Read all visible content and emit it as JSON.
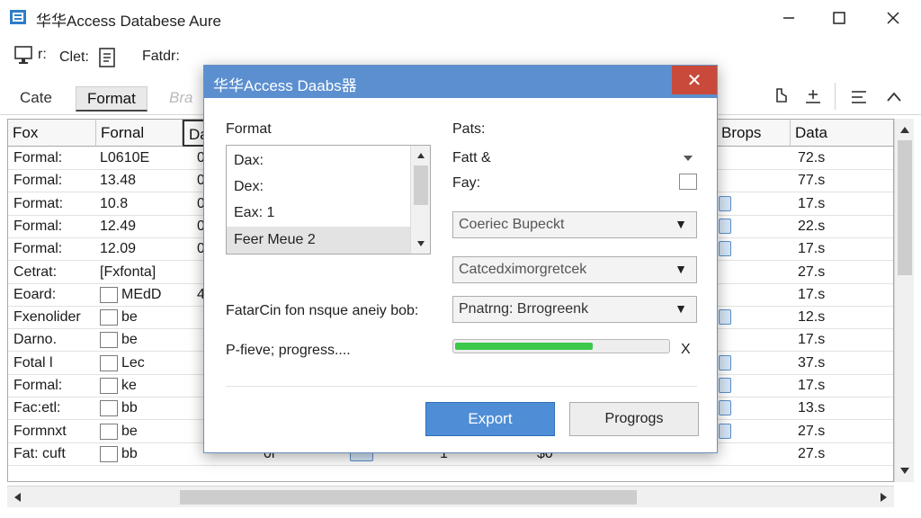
{
  "window": {
    "title": "华华Access Databese Aure",
    "minimize_icon": "minimize-icon",
    "maximize_icon": "maximize-icon",
    "close_icon": "close-icon"
  },
  "toolbar": {
    "item1_label": "r:",
    "item2_label": "Clet:",
    "item3_label": "Fatdr:"
  },
  "ribbon": {
    "tabs": [
      {
        "label": "Cate"
      },
      {
        "label": "Format"
      },
      {
        "label": "Bra"
      }
    ],
    "right_icons": [
      "bookmark-icon",
      "add-icon",
      "list-icon",
      "chevron-up-icon"
    ]
  },
  "grid": {
    "headers": [
      "Fox",
      "Fornal",
      "Da",
      "Brops",
      "Data"
    ],
    "rows": [
      {
        "c1": "Formal:",
        "c2": "L0610E",
        "c3": "0",
        "c5": "72.s",
        "box": false
      },
      {
        "c1": "Formal:",
        "c2": "13.48",
        "c3": "0",
        "c5": "77.s",
        "box": false
      },
      {
        "c1": "Format:",
        "c2": "10.8",
        "c3": "0",
        "c5": "17.s",
        "box": true
      },
      {
        "c1": "Formal:",
        "c2": "12.49",
        "c3": "0",
        "c5": "22.s",
        "box": true
      },
      {
        "c1": "Formal:",
        "c2": "12.09",
        "c3": "0",
        "c5": "17.s",
        "box": true
      },
      {
        "c1": "Cetrat:",
        "c2": "[Fxfonta]",
        "c3": "",
        "c5": "27.s",
        "box": false
      },
      {
        "c1": "Eoard:",
        "c2": "MEdD",
        "c3": "4",
        "c5": "17.s",
        "box": false,
        "cb": true
      },
      {
        "c1": "Fxenolider",
        "c2": "be",
        "c3": "",
        "c5": "12.s",
        "box": true,
        "cb": true
      },
      {
        "c1": "Darno.",
        "c2": "be",
        "c3": "",
        "c5": "17.s",
        "box": false,
        "cb": true
      },
      {
        "c1": "Fotal l",
        "c2": "Lec",
        "c3": "",
        "c5": "37.s",
        "box": true,
        "cb": true
      },
      {
        "c1": "Formal:",
        "c2": "ke",
        "c3": "",
        "c5": "17.s",
        "box": true,
        "cb": true
      },
      {
        "c1": "Fac:etl:",
        "c2": "bb",
        "c3": "",
        "c5": "13.s",
        "box": true,
        "cb": true
      },
      {
        "c1": "Formnxt",
        "c2": "be",
        "c3": "",
        "c5": "27.s",
        "box": true,
        "cb": true
      },
      {
        "c1": "Fat: cuft",
        "c2": "bb",
        "c3": "",
        "c4a": "0l",
        "c4b": "1",
        "c4c": "$0",
        "c5": "27.s",
        "box": false,
        "cb": true
      }
    ]
  },
  "dialog": {
    "title": "华华Access Daabs器",
    "close_label": "✕",
    "format_label": "Format",
    "format_items": [
      "Dax:",
      "Dex:",
      "Eax: 1",
      "Feer Meue 2"
    ],
    "format_selected_index": 3,
    "pats_label": "Pats:",
    "fatt_label": "Fatt &",
    "fay_label": "Fay:",
    "combo1": "Coeriec Bupeckt",
    "combo2": "Catcedximorgretcek",
    "fatar_label": "FatarCin fon nsque aneiy bob:",
    "combo3": "Pnatrng: Brrogreenk",
    "progress_label": "P-fieve; progress....",
    "progress_value": 0.65,
    "progress_close": "X",
    "export_label": "Export",
    "progress_button_label": "Progrogs",
    "accent_color": "#4f8ed6",
    "progress_color": "#3cc84a"
  }
}
